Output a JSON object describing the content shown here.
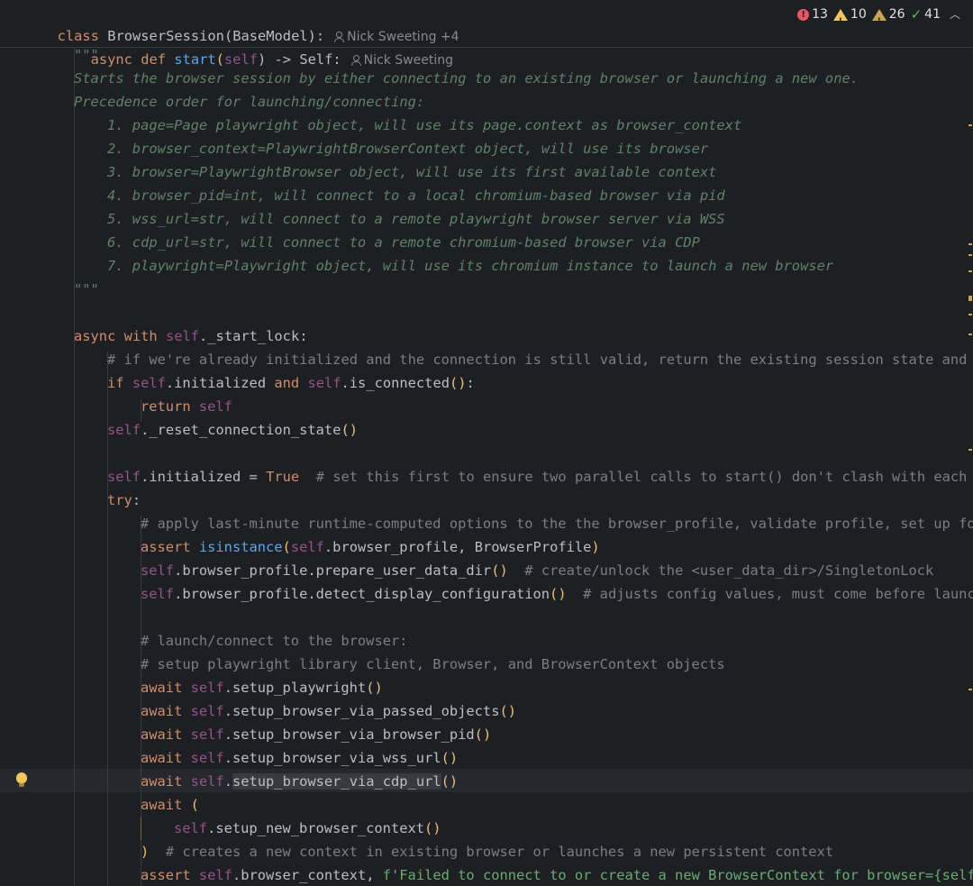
{
  "sticky": {
    "class_line": "class BrowserSession(BaseModel):",
    "class_author": "Nick Sweeting +4",
    "def_line": "async def start(self) -> Self:",
    "def_author": "Nick Sweeting"
  },
  "inspections": {
    "errors": "13",
    "warnings": "10",
    "weak_warnings": "26",
    "typos": "41"
  },
  "code": {
    "docstring_open": "\"\"\"",
    "doc1": "Starts the browser session by either connecting to an existing browser or launching a new one.",
    "doc2": "Precedence order for launching/connecting:",
    "doc_items": [
      "1. page=Page playwright object, will use its page.context as browser_context",
      "2. browser_context=PlaywrightBrowserContext object, will use its browser",
      "3. browser=PlaywrightBrowser object, will use its first available context",
      "4. browser_pid=int, will connect to a local chromium-based browser via pid",
      "5. wss_url=str, will connect to a remote playwright browser server via WSS",
      "6. cdp_url=str, will connect to a remote chromium-based browser via CDP",
      "7. playwright=Playwright object, will use its chromium instance to launch a new browser"
    ],
    "docstring_close": "\"\"\"",
    "comment_initialized": "# if we're already initialized and the connection is still valid, return the existing session state and s",
    "comment_set_first": "# set this first to ensure two parallel calls to start() don't clash with each o",
    "comment_apply": "# apply last-minute runtime-computed options to the the browser_profile, validate profile, set up fol",
    "comment_unlock": "# create/unlock the <user_data_dir>/SingletonLock",
    "comment_adjusts": "# adjusts config values, must come before launch",
    "comment_launch": "# launch/connect to the browser:",
    "comment_setup": "# setup playwright library client, Browser, and BrowserContext objects",
    "comment_creates": "# creates a new context in existing browser or launches a new persistent context",
    "assert_message": "f'Failed to connect to or create a new BrowserContext for browser={self"
  },
  "colors": {
    "background": "#1e1f22",
    "keyword": "#cf8e6d",
    "function": "#56a8f5",
    "self": "#94558d",
    "docstring": "#5f826b",
    "comment": "#7a7e85",
    "string": "#6aab73"
  },
  "icons": {
    "error": "error-icon",
    "warning": "warning-icon",
    "weak_warning": "weak-warning-icon",
    "typo": "typo-check-icon",
    "author": "person-icon",
    "intention": "lightbulb-icon"
  }
}
